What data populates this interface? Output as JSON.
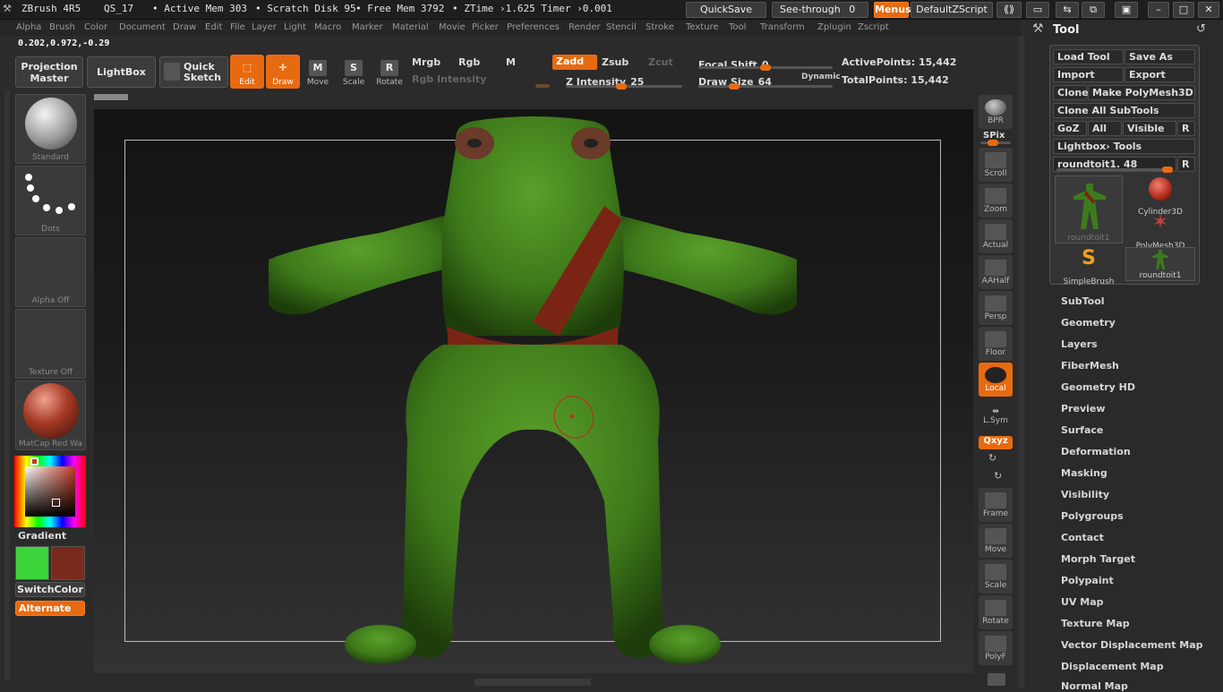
{
  "titlebar": {
    "app": "ZBrush 4R5",
    "doc": "QS_17",
    "active_mem": "• Active Mem 303",
    "scratch": "• Scratch Disk 95",
    "free_mem": "• Free Mem 3792",
    "ztime": "• ZTime ›1.625 Timer ›0.001",
    "quicksave": "QuickSave",
    "see_through": "See-through",
    "see_through_val": "0",
    "menus": "Menus",
    "zscript": "DefaultZScript"
  },
  "menubar": [
    "Alpha",
    "Brush",
    "Color",
    "Document",
    "Draw",
    "Edit",
    "File",
    "Layer",
    "Light",
    "Macro",
    "Marker",
    "Material",
    "Movie",
    "Picker",
    "Preferences",
    "Render",
    "Stencil",
    "Stroke",
    "Texture",
    "Tool",
    "Transform",
    "Zplugin",
    "Zscript"
  ],
  "coords": "0.202,0.972,-0.29",
  "topshelf": {
    "projection_master": [
      "Projection",
      "Master"
    ],
    "lightbox": "LightBox",
    "quick_sketch": [
      "Quick",
      "Sketch"
    ],
    "edit": "Edit",
    "draw": "Draw",
    "move": "Move",
    "scale": "Scale",
    "rotate": "Rotate",
    "mrgb": "Mrgb",
    "rgb": "Rgb",
    "m": "M",
    "rgb_intensity": "Rgb Intensity",
    "zadd": "Zadd",
    "zsub": "Zsub",
    "zcut": "Zcut",
    "z_intensity": "Z Intensity",
    "z_intensity_val": "25",
    "focal_shift": "Focal Shift",
    "focal_shift_val": "0",
    "draw_size": "Draw Size",
    "draw_size_val": "64",
    "dynamic": "Dynamic",
    "active_points": "ActivePoints: 15,442",
    "total_points": "TotalPoints: 15,442"
  },
  "leftshelf": {
    "brush": "Standard",
    "stroke": "Dots",
    "alpha": "Alpha Off",
    "texture": "Texture Off",
    "material": "MatCap Red Wa",
    "gradient": "Gradient",
    "switch_color": "SwitchColor",
    "alternate": "Alternate",
    "colors": {
      "main": "#3bd43b",
      "secondary": "#7a2a1c"
    }
  },
  "rightshelf": {
    "bpr": "BPR",
    "spix": "SPix",
    "scroll": "Scroll",
    "zoom": "Zoom",
    "actual": "Actual",
    "aahalf": "AAHalf",
    "persp": "Persp",
    "floor": "Floor",
    "local": "Local",
    "lsym": "L.Sym",
    "xyz": "Qxyz",
    "frame": "Frame",
    "move": "Move",
    "scale": "Scale",
    "rotate": "Rotate",
    "polyf": "PolyF"
  },
  "toolpanel": {
    "title": "Tool",
    "load_tool": "Load Tool",
    "save_as": "Save As",
    "import": "Import",
    "export": "Export",
    "clone": "Clone",
    "make_polymesh": "Make PolyMesh3D",
    "clone_all": "Clone All SubTools",
    "goz": "GoZ",
    "all": "All",
    "visible": "Visible",
    "r": "R",
    "lightbox_tools": "Lightbox› Tools",
    "current_tool": "roundtoit1. 48",
    "tools": [
      {
        "name": "roundtoit1",
        "icon": "frog-thumb-icon"
      },
      {
        "name": "Cylinder3D",
        "icon": "cylinder-icon"
      },
      {
        "name": "PolyMesh3D",
        "icon": "star-icon"
      },
      {
        "name": "SimpleBrush",
        "icon": "simplebrush-icon"
      },
      {
        "name": "roundtoit1",
        "icon": "frog-small-icon"
      }
    ],
    "menu": [
      "SubTool",
      "Geometry",
      "Layers",
      "FiberMesh",
      "Geometry HD",
      "Preview",
      "Surface",
      "Deformation",
      "Masking",
      "Visibility",
      "Polygroups",
      "Contact",
      "Morph Target",
      "Polypaint",
      "UV Map",
      "Texture Map",
      "Vector Displacement Map",
      "Displacement Map",
      "Normal Map"
    ]
  }
}
